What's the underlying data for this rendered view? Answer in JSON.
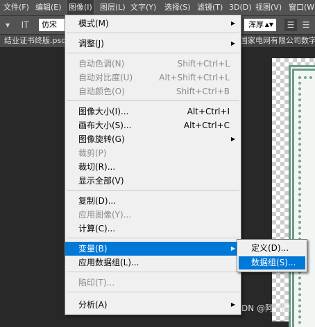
{
  "menubar": {
    "items": [
      "文件(F)",
      "编辑(E)",
      "图像(I)",
      "图层(L)",
      "文字(Y)",
      "选择(S)",
      "滤镜(T)",
      "3D(D)",
      "视图(V)",
      "窗口(W"
    ]
  },
  "options": {
    "tool_icon": "IT",
    "font_value": "仿宋",
    "antialias_value": "浑厚"
  },
  "tabs": {
    "left": "结业证书终版.psd",
    "right": "国家电网有限公司数字化"
  },
  "image_menu": {
    "items": [
      {
        "label": "模式(M)",
        "shortcut": "",
        "submenu": true,
        "disabled": false
      },
      {
        "label": "调整(J)",
        "shortcut": "",
        "submenu": true,
        "disabled": false
      },
      {
        "label": "自动色调(N)",
        "shortcut": "Shift+Ctrl+L",
        "submenu": false,
        "disabled": true
      },
      {
        "label": "自动对比度(U)",
        "shortcut": "Alt+Shift+Ctrl+L",
        "submenu": false,
        "disabled": true
      },
      {
        "label": "自动颜色(O)",
        "shortcut": "Shift+Ctrl+B",
        "submenu": false,
        "disabled": true
      },
      {
        "label": "图像大小(I)...",
        "shortcut": "Alt+Ctrl+I",
        "submenu": false,
        "disabled": false
      },
      {
        "label": "画布大小(S)...",
        "shortcut": "Alt+Ctrl+C",
        "submenu": false,
        "disabled": false
      },
      {
        "label": "图像旋转(G)",
        "shortcut": "",
        "submenu": true,
        "disabled": false
      },
      {
        "label": "裁剪(P)",
        "shortcut": "",
        "submenu": false,
        "disabled": true
      },
      {
        "label": "裁切(R)...",
        "shortcut": "",
        "submenu": false,
        "disabled": false
      },
      {
        "label": "显示全部(V)",
        "shortcut": "",
        "submenu": false,
        "disabled": false
      },
      {
        "label": "复制(D)...",
        "shortcut": "",
        "submenu": false,
        "disabled": false
      },
      {
        "label": "应用图像(Y)...",
        "shortcut": "",
        "submenu": false,
        "disabled": true
      },
      {
        "label": "计算(C)...",
        "shortcut": "",
        "submenu": false,
        "disabled": false
      },
      {
        "label": "变量(B)",
        "shortcut": "",
        "submenu": true,
        "disabled": false
      },
      {
        "label": "应用数据组(L)...",
        "shortcut": "",
        "submenu": false,
        "disabled": false
      },
      {
        "label": "陷印(T)...",
        "shortcut": "",
        "submenu": false,
        "disabled": true
      },
      {
        "label": "分析(A)",
        "shortcut": "",
        "submenu": true,
        "disabled": false
      }
    ]
  },
  "variables_submenu": {
    "items": [
      "定义(D)...",
      "数据组(S)..."
    ]
  },
  "watermark": "CSDN @阿**阳",
  "colors": {
    "highlight": "#0078d7",
    "menu_bg": "#f0f0f0",
    "chrome_bg": "#535353"
  }
}
